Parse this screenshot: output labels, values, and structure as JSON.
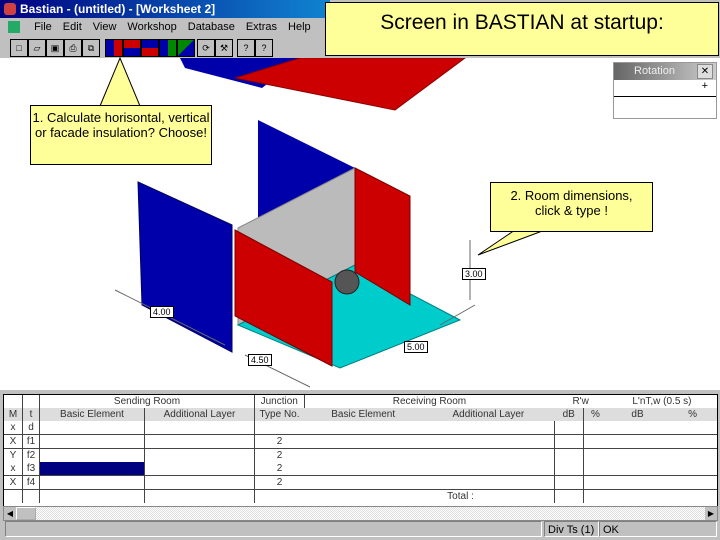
{
  "window": {
    "title": "Bastian - (untitled) - [Worksheet 2]"
  },
  "menu": [
    "File",
    "Edit",
    "View",
    "Workshop",
    "Database",
    "Extras",
    "Help"
  ],
  "headline": "Screen in BASTIAN at startup:",
  "callouts": {
    "c1": "1.   Calculate horisontal, vertical or facade insulation? Choose!",
    "c2": "2. Room dimensions, click & type !"
  },
  "rotation_panel": {
    "title": "Rotation",
    "plus": "+"
  },
  "dimensions": {
    "d1": "4.00",
    "d2": "4.50",
    "d3": "5.00",
    "d4": "3.00"
  },
  "table": {
    "group_headers": [
      "Sending Room",
      "Junction",
      "Receiving Room",
      "R'w",
      "L'nT,w (0.5 s)"
    ],
    "headers": [
      "M",
      "t",
      "Basic Element",
      "Additional Layer",
      "Type No.",
      "Basic Element",
      "Additional Layer",
      "dB",
      "%",
      "dB",
      "%"
    ],
    "rows": [
      {
        "m": "x",
        "t": "d",
        "type": ""
      },
      {
        "m": "X",
        "t": "f1",
        "type": "2"
      },
      {
        "m": "Y",
        "t": "f2",
        "type": "2"
      },
      {
        "m": "x",
        "t": "f3",
        "type": "2"
      },
      {
        "m": "X",
        "t": "f4",
        "type": "2"
      }
    ],
    "total": "Total :"
  },
  "status": {
    "left": "",
    "dim": "Div Ts (1)",
    "ok": "OK"
  }
}
